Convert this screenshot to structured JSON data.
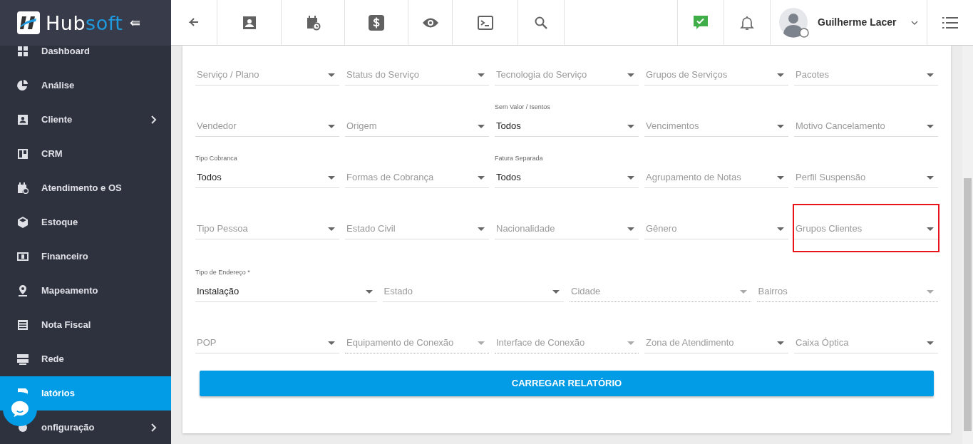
{
  "brand": {
    "name_start": "Hub",
    "name_end": "soft",
    "collapse_glyph": "⇚"
  },
  "user": {
    "name": "Guilherme Lacer"
  },
  "sidebar": {
    "items": [
      {
        "label": "Dashboard",
        "selected": false,
        "has_submenu": false
      },
      {
        "label": "Análise",
        "selected": false,
        "has_submenu": false
      },
      {
        "label": "Cliente",
        "selected": false,
        "has_submenu": true
      },
      {
        "label": "CRM",
        "selected": false,
        "has_submenu": false
      },
      {
        "label": "Atendimento e OS",
        "selected": false,
        "has_submenu": false
      },
      {
        "label": "Estoque",
        "selected": false,
        "has_submenu": false
      },
      {
        "label": "Financeiro",
        "selected": false,
        "has_submenu": false
      },
      {
        "label": "Mapeamento",
        "selected": false,
        "has_submenu": false
      },
      {
        "label": "Nota Fiscal",
        "selected": false,
        "has_submenu": false
      },
      {
        "label": "Rede",
        "selected": false,
        "has_submenu": false
      },
      {
        "label": "latórios",
        "selected": true,
        "has_submenu": false
      },
      {
        "label": "onfiguração",
        "selected": false,
        "has_submenu": true
      }
    ]
  },
  "filters": {
    "rows": [
      {
        "fields": [
          {
            "placeholder": "Serviço / Plano",
            "disabled": false,
            "highlighted": false
          },
          {
            "placeholder": "Status do Serviço",
            "disabled": false,
            "highlighted": false
          },
          {
            "placeholder": "Tecnologia do Serviço",
            "disabled": false,
            "highlighted": false
          },
          {
            "placeholder": "Grupos de Serviços",
            "disabled": false,
            "highlighted": false
          },
          {
            "placeholder": "Pacotes",
            "disabled": false,
            "highlighted": false
          }
        ]
      },
      {
        "fields": [
          {
            "placeholder": "Vendedor",
            "disabled": false,
            "highlighted": false
          },
          {
            "placeholder": "Origem",
            "disabled": false,
            "highlighted": false
          },
          {
            "label": "Sem Valor / Isentos",
            "value": "Todos",
            "disabled": false,
            "highlighted": false
          },
          {
            "placeholder": "Vencimentos",
            "disabled": false,
            "highlighted": false
          },
          {
            "placeholder": "Motivo Cancelamento",
            "disabled": false,
            "highlighted": false
          }
        ]
      },
      {
        "fields": [
          {
            "label": "Tipo Cobranca",
            "value": "Todos",
            "disabled": false,
            "highlighted": false
          },
          {
            "placeholder": "Formas de Cobrança",
            "disabled": false,
            "highlighted": false
          },
          {
            "label": "Fatura Separada",
            "value": "Todos",
            "disabled": false,
            "highlighted": false
          },
          {
            "placeholder": "Agrupamento de Notas",
            "disabled": false,
            "highlighted": false
          },
          {
            "placeholder": "Perfil Suspensão",
            "disabled": false,
            "highlighted": false
          }
        ]
      },
      {
        "fields": [
          {
            "placeholder": "Tipo Pessoa",
            "disabled": false,
            "highlighted": false
          },
          {
            "placeholder": "Estado Civil",
            "disabled": false,
            "highlighted": false
          },
          {
            "placeholder": "Nacionalidade",
            "disabled": false,
            "highlighted": false
          },
          {
            "placeholder": "Gênero",
            "disabled": false,
            "highlighted": false
          },
          {
            "placeholder": "Grupos Clientes",
            "disabled": false,
            "highlighted": true
          }
        ]
      },
      {
        "fields": [
          {
            "label": "Tipo de Endereço *",
            "value": "Instalação",
            "disabled": false,
            "highlighted": false
          },
          {
            "placeholder": "Estado",
            "disabled": false,
            "highlighted": false
          },
          {
            "placeholder": "Cidade",
            "disabled": true,
            "highlighted": false
          },
          {
            "placeholder": "Bairros",
            "disabled": true,
            "highlighted": false
          }
        ]
      },
      {
        "fields": [
          {
            "placeholder": "POP",
            "disabled": false,
            "highlighted": false
          },
          {
            "placeholder": "Equipamento de Conexão",
            "disabled": true,
            "highlighted": false
          },
          {
            "placeholder": "Interface de Conexão",
            "disabled": true,
            "highlighted": false
          },
          {
            "placeholder": "Zona de Atendimento",
            "disabled": false,
            "highlighted": false
          },
          {
            "placeholder": "Caixa Óptica",
            "disabled": false,
            "highlighted": false
          }
        ]
      }
    ]
  },
  "submit_button": "CARREGAR RELATÓRIO"
}
